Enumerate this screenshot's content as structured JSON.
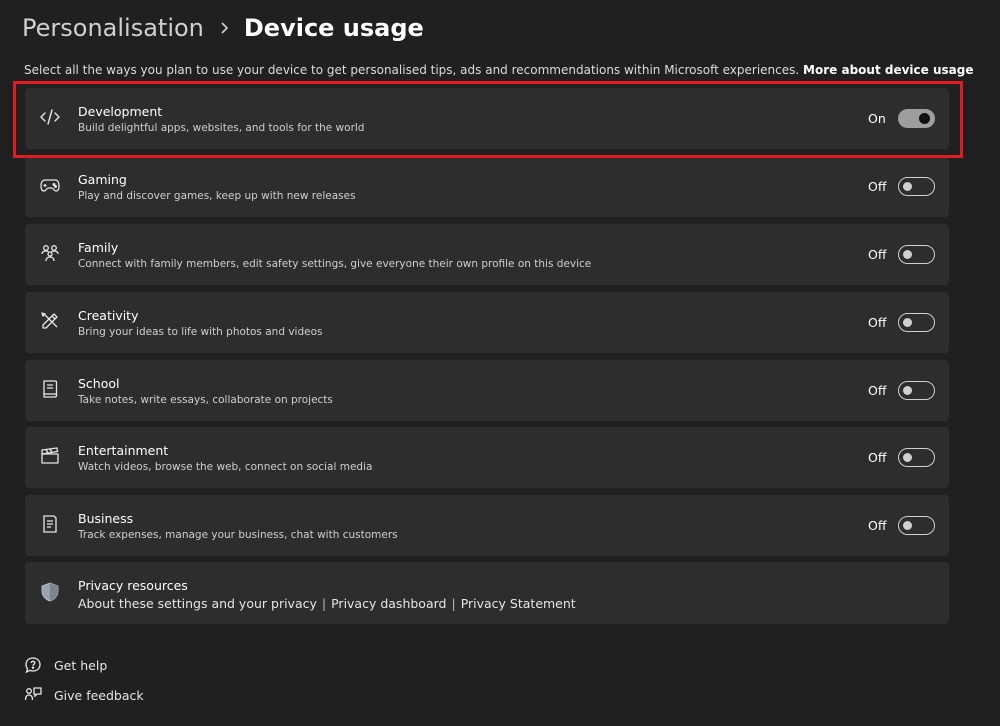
{
  "header": {
    "parent": "Personalisation",
    "separator_icon": "chevron-right-icon",
    "current": "Device usage"
  },
  "intro": {
    "text": "Select all the ways you plan to use your device to get personalised tips, ads and recommendations within Microsoft experiences.",
    "link": "More about device usage"
  },
  "items": [
    {
      "icon": "code-icon",
      "title": "Development",
      "desc": "Build delightful apps, websites, and tools for the world",
      "state": "On",
      "on": true,
      "highlighted": true
    },
    {
      "icon": "gamepad-icon",
      "title": "Gaming",
      "desc": "Play and discover games, keep up with new releases",
      "state": "Off",
      "on": false
    },
    {
      "icon": "family-icon",
      "title": "Family",
      "desc": "Connect with family members, edit safety settings, give everyone their own profile on this device",
      "state": "Off",
      "on": false
    },
    {
      "icon": "brush-pencil-icon",
      "title": "Creativity",
      "desc": "Bring your ideas to life with photos and videos",
      "state": "Off",
      "on": false
    },
    {
      "icon": "notebook-icon",
      "title": "School",
      "desc": "Take notes, write essays, collaborate on projects",
      "state": "Off",
      "on": false
    },
    {
      "icon": "clapperboard-icon",
      "title": "Entertainment",
      "desc": "Watch videos, browse the web, connect on social media",
      "state": "Off",
      "on": false
    },
    {
      "icon": "document-icon",
      "title": "Business",
      "desc": "Track expenses, manage your business, chat with customers",
      "state": "Off",
      "on": false
    }
  ],
  "privacy": {
    "icon": "shield-icon",
    "title": "Privacy resources",
    "links": [
      "About these settings and your privacy",
      "Privacy dashboard",
      "Privacy Statement"
    ],
    "separator": "|"
  },
  "footer": {
    "help": {
      "icon": "help-chat-icon",
      "label": "Get help"
    },
    "feedback": {
      "icon": "feedback-icon",
      "label": "Give feedback"
    }
  },
  "colors": {
    "background": "#202020",
    "card": "#2d2d2d",
    "highlight_border": "#e11b22"
  }
}
